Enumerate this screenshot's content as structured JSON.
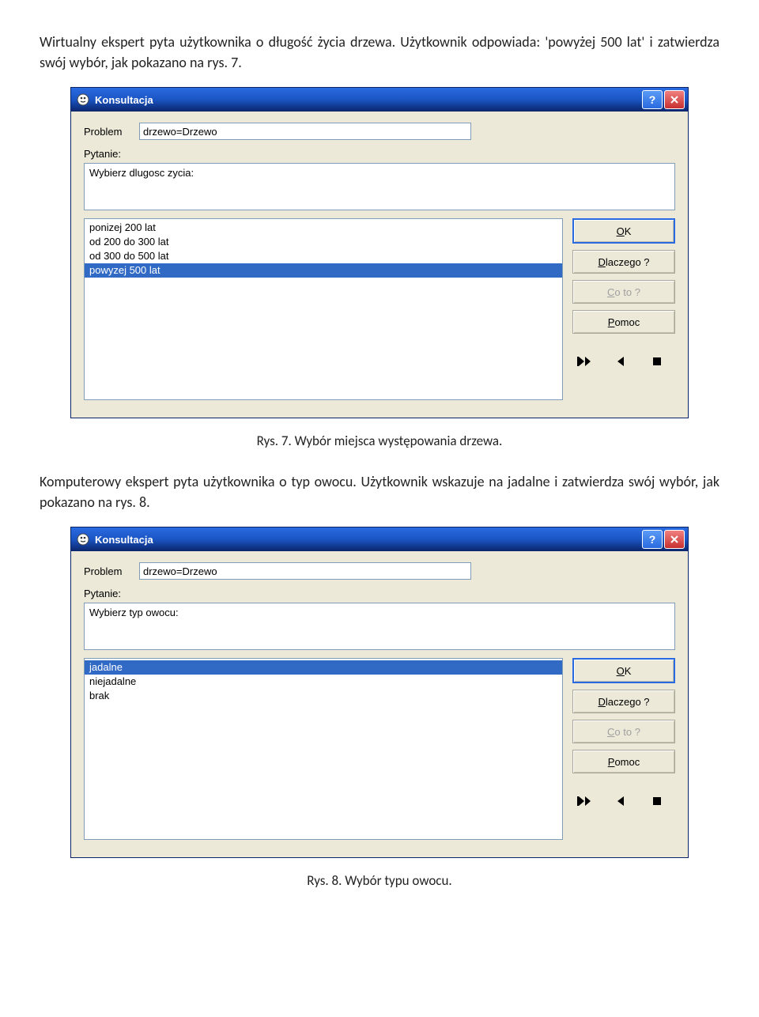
{
  "paragraph1_a": "Wirtualny ekspert pyta użytkownika o długość życia drzewa. Użytkownik odpowiada: ",
  "paragraph1_b": "'powyżej 500 lat' i zatwierdza swój wybór, jak pokazano na rys. 7.",
  "caption1": "Rys. 7. Wybór miejsca występowania drzewa.",
  "paragraph2_a": "Komputerowy ekspert pyta użytkownika o typ owocu. Użytkownik wskazuje na jadalne i ",
  "paragraph2_b": "zatwierdza swój wybór, jak pokazano na rys. 8.",
  "caption2": "Rys. 8. Wybór typu owocu.",
  "dialog": {
    "title": "Konsultacja",
    "problem_label": "Problem",
    "question_label": "Pytanie:",
    "problem_value": "drzewo=Drzewo",
    "buttons": {
      "ok": "OK",
      "why": "Dlaczego ?",
      "what": "Co to ?",
      "help": "Pomoc"
    }
  },
  "dialog1": {
    "question": "Wybierz  dlugosc zycia:",
    "options": [
      "ponizej 200 lat",
      "od 200 do 300 lat",
      "od 300 do 500 lat",
      "powyzej 500 lat"
    ],
    "selected_index": 3
  },
  "dialog2": {
    "question": "Wybierz typ owocu:",
    "options": [
      "jadalne",
      "niejadalne",
      "brak"
    ],
    "selected_index": 0
  }
}
